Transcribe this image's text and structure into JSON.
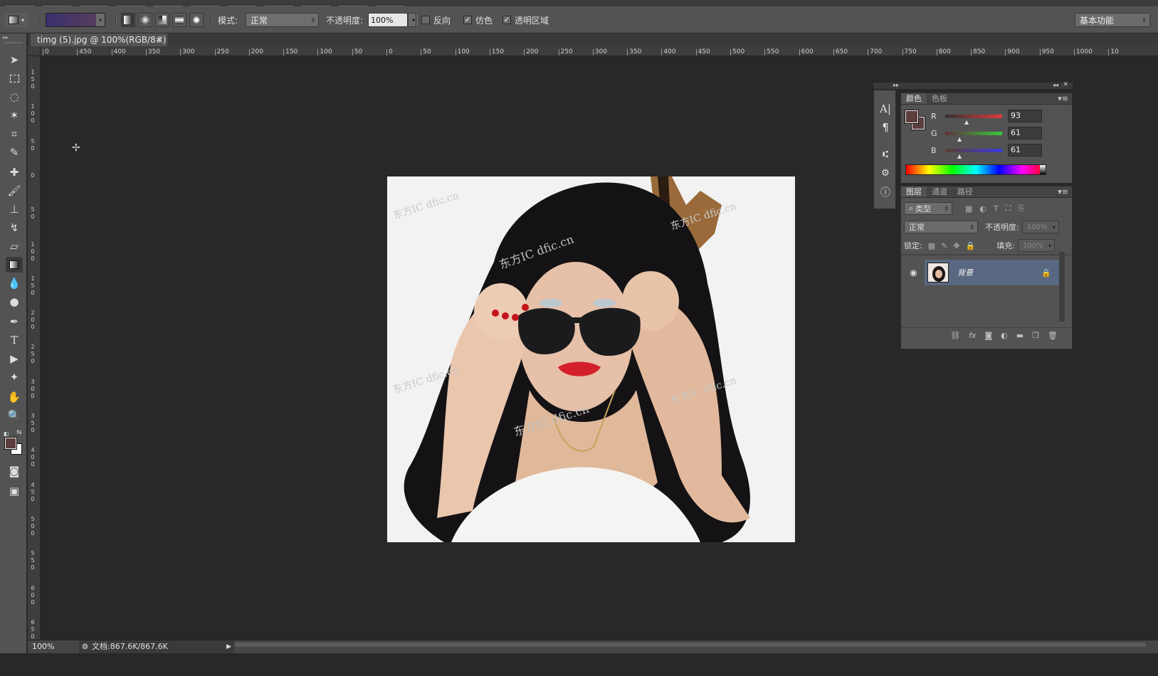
{
  "options_bar": {
    "mode_label": "模式:",
    "mode_value": "正常",
    "opacity_label": "不透明度:",
    "opacity_value": "100%",
    "reverse_label": "反向",
    "dither_label": "仿色",
    "transparency_label": "透明区域",
    "dither_checked": "✓",
    "transparency_checked": "✓",
    "workspace_value": "基本功能",
    "gradient_colors": [
      "#3a2f6e",
      "#5a3f5a"
    ]
  },
  "document": {
    "tab_title": "timg (5).jpg @ 100%(RGB/8#)",
    "tab_close": "×"
  },
  "rulers": {
    "horizontal": [
      "0",
      "450",
      "400",
      "350",
      "300",
      "250",
      "200",
      "150",
      "100",
      "50",
      "0",
      "50",
      "100",
      "150",
      "200",
      "250",
      "300",
      "350",
      "400",
      "450",
      "500",
      "550",
      "600",
      "650",
      "700",
      "750",
      "800",
      "850",
      "900",
      "950",
      "1000",
      "10"
    ],
    "vertical": [
      "1 5 0",
      "1 0 0",
      "5 0",
      "0",
      "5 0",
      "1 0 0",
      "1 5 0",
      "2 0 0",
      "2 5 0",
      "3 0 0",
      "3 5 0",
      "4 0 0",
      "4 5 0",
      "5 0 0",
      "5 5 0",
      "6 0 0",
      "6 5 0"
    ]
  },
  "color_panel": {
    "tabs": [
      "颜色",
      "色板"
    ],
    "menu_icon": "menu-icon",
    "r_label": "R",
    "r_value": "93",
    "g_label": "G",
    "g_value": "61",
    "b_label": "B",
    "b_value": "61",
    "foreground": "#5d3d3d",
    "background": "#ffffff"
  },
  "layers_panel": {
    "tabs": [
      "图层",
      "通道",
      "路径"
    ],
    "filter_label": "类型",
    "blend_mode": "正常",
    "opacity_label": "不透明度:",
    "opacity_value": "100%",
    "lock_label": "锁定:",
    "fill_label": "填充:",
    "fill_value": "100%",
    "layer_name": "背景",
    "footer_icons": [
      "link-icon",
      "fx-icon",
      "mask-icon",
      "adjustment-icon",
      "folder-icon",
      "new-layer-icon",
      "trash-icon"
    ]
  },
  "status": {
    "zoom": "100%",
    "doc_size": "文档:867.6K/867.6K"
  },
  "photo": {
    "watermarks": [
      "东方IC",
      "dfic.cn",
      "东方IC dfic.cn"
    ]
  }
}
